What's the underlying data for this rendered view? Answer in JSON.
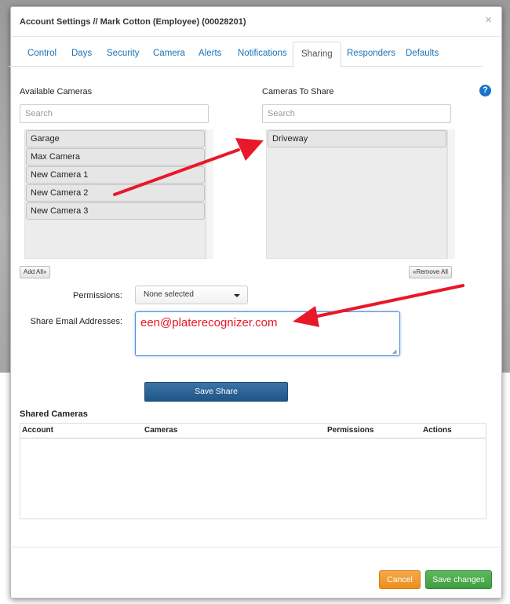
{
  "dialog": {
    "title": "Account Settings // Mark Cotton (Employee) (00028201)",
    "close_glyph": "×"
  },
  "tabs": [
    {
      "label": "Control"
    },
    {
      "label": "Days"
    },
    {
      "label": "Security"
    },
    {
      "label": "Camera"
    },
    {
      "label": "Alerts"
    },
    {
      "label": "Notifications"
    },
    {
      "label": "Sharing",
      "active": true
    },
    {
      "label": "Responders"
    },
    {
      "label": "Defaults"
    }
  ],
  "help_glyph": "?",
  "available": {
    "title": "Available Cameras",
    "search_placeholder": "Search",
    "items": [
      "Garage",
      "Max Camera",
      "New Camera 1",
      "New Camera 2",
      "New Camera 3"
    ],
    "add_all_label": "Add All»"
  },
  "to_share": {
    "title": "Cameras To Share",
    "search_placeholder": "Search",
    "items": [
      "Driveway"
    ],
    "remove_all_label": "«Remove All"
  },
  "form": {
    "permissions_label": "Permissions:",
    "permissions_value": "None selected",
    "email_label": "Share Email Addresses:",
    "email_value": "een@platerecognizer.com",
    "save_share_label": "Save Share"
  },
  "shared": {
    "title": "Shared Cameras",
    "columns": [
      "Account",
      "Cameras",
      "Permissions",
      "Actions"
    ]
  },
  "footer": {
    "cancel_label": "Cancel",
    "save_label": "Save changes"
  },
  "colors": {
    "annotation_arrow": "#e8182a",
    "accent": "#1a73b8",
    "cancel": "#ec8e1b",
    "save": "#449d44"
  }
}
